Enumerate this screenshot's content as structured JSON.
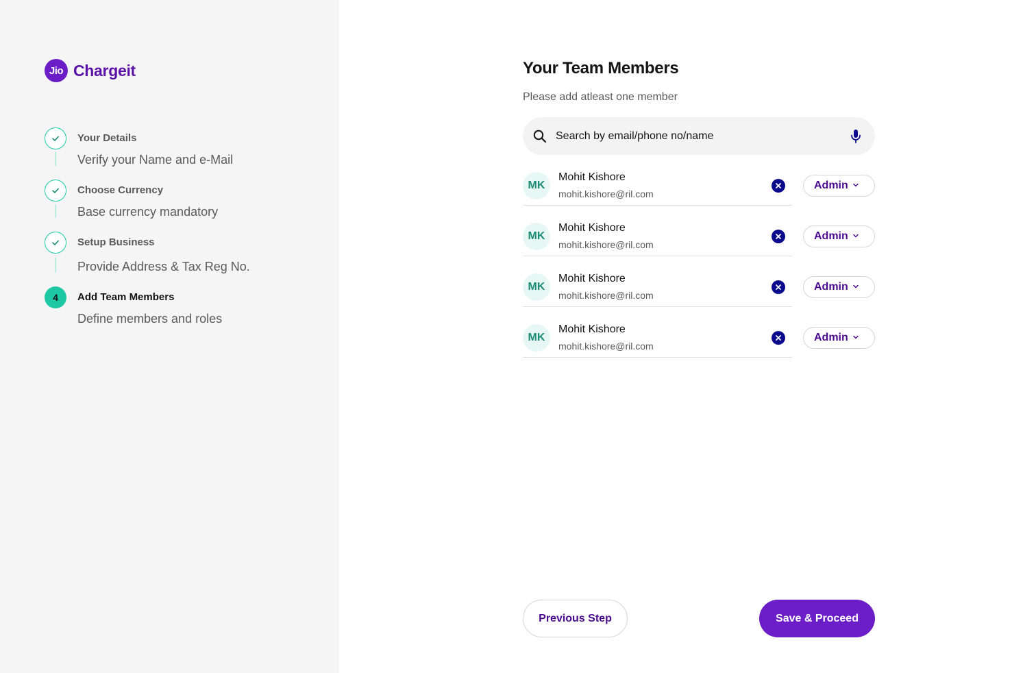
{
  "brand": {
    "badge": "Jio",
    "name": "Chargeit"
  },
  "steps": [
    {
      "title": "Your Details",
      "subtitle": "Verify your Name and e-Mail",
      "status": "done"
    },
    {
      "title": "Choose Currency",
      "subtitle": "Base currency mandatory",
      "status": "done"
    },
    {
      "title": "Setup Business",
      "subtitle": "Provide Address & Tax Reg No.",
      "status": "done"
    },
    {
      "title": "Add Team Members",
      "subtitle": "Define members and roles",
      "status": "active",
      "number": "4"
    }
  ],
  "main": {
    "title": "Your Team Members",
    "subtitle": "Please add atleast one member",
    "search_placeholder": "Search by email/phone no/name"
  },
  "members": [
    {
      "initials": "MK",
      "name": "Mohit Kishore",
      "email": "mohit.kishore@ril.com",
      "role": "Admin"
    },
    {
      "initials": "MK",
      "name": "Mohit Kishore",
      "email": "mohit.kishore@ril.com",
      "role": "Admin"
    },
    {
      "initials": "MK",
      "name": "Mohit Kishore",
      "email": "mohit.kishore@ril.com",
      "role": "Admin"
    },
    {
      "initials": "MK",
      "name": "Mohit Kishore",
      "email": "mohit.kishore@ril.com",
      "role": "Admin"
    }
  ],
  "actions": {
    "previous": "Previous Step",
    "save": "Save & Proceed"
  },
  "colors": {
    "brand": "#6b1ec8",
    "step_accent": "#1ec8a5",
    "remove_icon": "#0a0a8c"
  }
}
